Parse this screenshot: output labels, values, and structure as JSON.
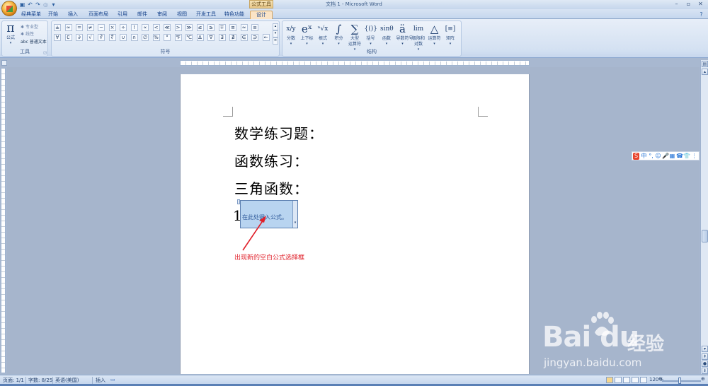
{
  "window": {
    "title": "文档 1 - Microsoft Word",
    "context_tool": "公式工具",
    "controls": [
      "–",
      "▫",
      "✕"
    ]
  },
  "tabs": [
    "经典菜单",
    "开始",
    "插入",
    "页面布局",
    "引用",
    "邮件",
    "审阅",
    "视图",
    "开发工具",
    "特色功能",
    "设计"
  ],
  "ribbon": {
    "tools_group": {
      "label": "工具",
      "equation_label": "公式",
      "options": [
        "专业型",
        "线性",
        "普通文本"
      ]
    },
    "symbols_group": {
      "label": "符号",
      "row1": [
        "±",
        "∞",
        "=",
        "≠",
        "~",
        "×",
        "÷",
        "!",
        "∝",
        "<",
        "≪",
        ">",
        "≫",
        "≤",
        "≥",
        "∓",
        "≅",
        "≈",
        "≡"
      ],
      "row2": [
        "∀",
        "∁",
        "∂",
        "√",
        "∛",
        "∜",
        "∪",
        "∩",
        "∅",
        "%",
        "°",
        "℉",
        "℃",
        "∆",
        "∇",
        "∃",
        "∄",
        "∈",
        "∋",
        "←"
      ]
    },
    "structures_group": {
      "label": "结构",
      "buttons": [
        {
          "glyph": "x/y",
          "label": "分数"
        },
        {
          "glyph": "eˣ",
          "label": "上下标"
        },
        {
          "glyph": "ⁿ√x",
          "label": "根式"
        },
        {
          "glyph": "∫",
          "label": "积分"
        },
        {
          "glyph": "∑",
          "label": "大型",
          "label2": "运算符"
        },
        {
          "glyph": "{()}",
          "label": "括号"
        },
        {
          "glyph": "sinθ",
          "label": "函数"
        },
        {
          "glyph": "ä",
          "label": "导数符号"
        },
        {
          "glyph": "lim",
          "label": "极限和",
          "label2": "对数"
        },
        {
          "glyph": "△",
          "label": "运算符"
        },
        {
          "glyph": "[≡]",
          "label": "矩阵"
        }
      ]
    }
  },
  "document": {
    "lines": [
      "数学练习题：",
      "函数练习：",
      "三角函数："
    ],
    "equation_line_prefix": "1",
    "equation_placeholder": "在此处键入公式。"
  },
  "annotation": {
    "text": "出现新的空白公式选择框",
    "color": "#e0202a"
  },
  "ime_bar": {
    "items": [
      "S",
      "中",
      "°,",
      "☺",
      "🎤",
      "▦",
      "☎",
      "👕",
      "⋮"
    ]
  },
  "statusbar": {
    "page": "页面: 1/1",
    "words": "字数: 8/25",
    "language": "英语(美国)",
    "mode": "插入",
    "zoom": "120%",
    "zoom_minus": "⊖",
    "zoom_plus": "⊕"
  },
  "watermark": {
    "logo": "Bai du",
    "chinese": "经验",
    "url": "jingyan.baidu.com"
  }
}
